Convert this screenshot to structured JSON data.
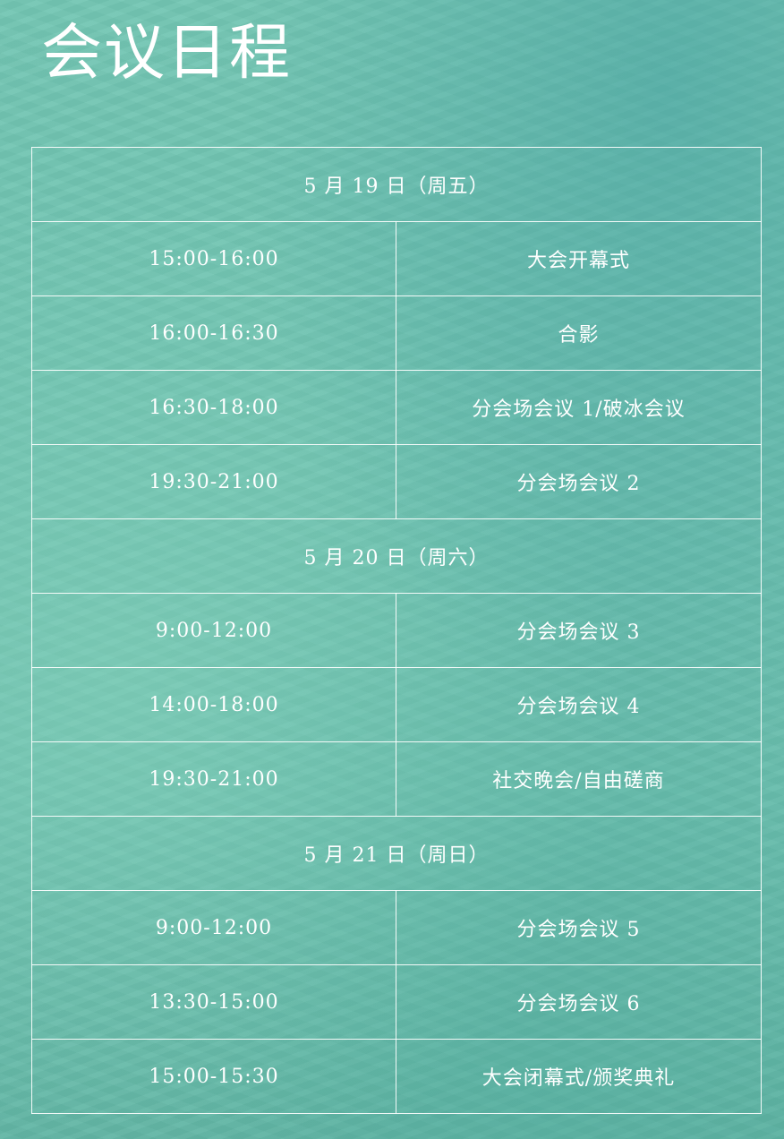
{
  "page": {
    "title": "会议日程"
  },
  "schedule": [
    {
      "day": "5 月 19 日（周五）",
      "sessions": [
        {
          "time": "15:00-16:00",
          "event": "大会开幕式"
        },
        {
          "time": "16:00-16:30",
          "event": "合影"
        },
        {
          "time": "16:30-18:00",
          "event": "分会场会议 1/破冰会议"
        },
        {
          "time": "19:30-21:00",
          "event": "分会场会议 2"
        }
      ]
    },
    {
      "day": "5 月 20 日（周六）",
      "sessions": [
        {
          "time": "9:00-12:00",
          "event": "分会场会议 3"
        },
        {
          "time": "14:00-18:00",
          "event": "分会场会议 4"
        },
        {
          "time": "19:30-21:00",
          "event": "社交晚会/自由磋商"
        }
      ]
    },
    {
      "day": "5 月 21 日（周日）",
      "sessions": [
        {
          "time": "9:00-12:00",
          "event": "分会场会议 5"
        },
        {
          "time": "13:30-15:00",
          "event": "分会场会议 6"
        },
        {
          "time": "15:00-15:30",
          "event": "大会闭幕式/颁奖典礼"
        }
      ]
    }
  ],
  "colors": {
    "background": "#6ec2b0",
    "text": "#ffffff",
    "border": "#ffffff"
  }
}
